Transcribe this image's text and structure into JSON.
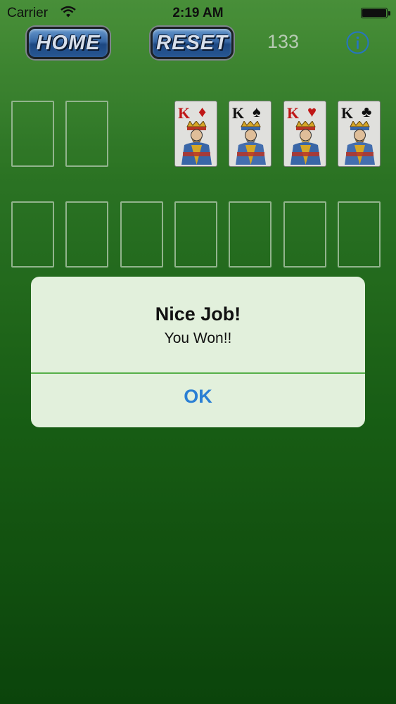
{
  "status_bar": {
    "carrier": "Carrier",
    "time": "2:19 AM"
  },
  "toolbar": {
    "home_label": "HOME",
    "reset_label": "RESET",
    "score": "133",
    "info_icon": "info-icon"
  },
  "foundations": [
    {
      "rank": "K",
      "suit": "♦",
      "suit_name": "diamonds",
      "color": "#d01818"
    },
    {
      "rank": "K",
      "suit": "♠",
      "suit_name": "spades",
      "color": "#111111"
    },
    {
      "rank": "K",
      "suit": "♥",
      "suit_name": "hearts",
      "color": "#d01818"
    },
    {
      "rank": "K",
      "suit": "♣",
      "suit_name": "clubs",
      "color": "#111111"
    }
  ],
  "alert": {
    "title": "Nice Job!",
    "message": "You Won!!",
    "ok_label": "OK"
  },
  "colors": {
    "table_green": "#2f7d27",
    "alert_bg": "#e2f0dc",
    "ok_blue": "#2a7fd4",
    "button_blue": "#3b6fb2"
  }
}
